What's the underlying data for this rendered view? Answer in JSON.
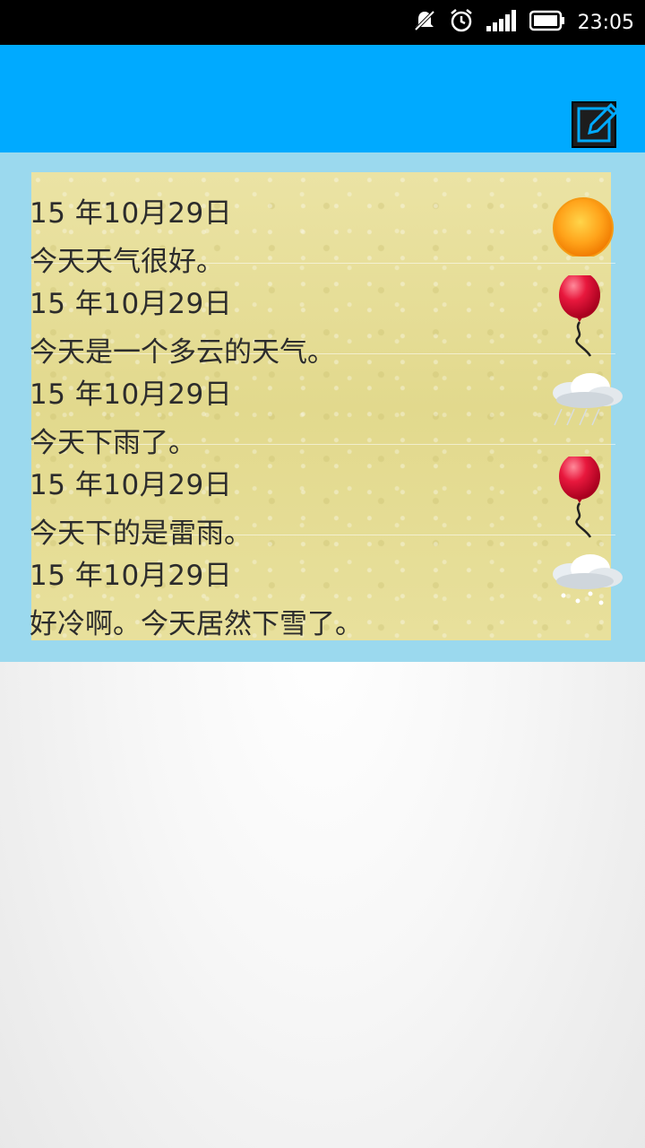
{
  "status_bar": {
    "time": "23:05",
    "icons": [
      "notifications-muted-icon",
      "alarm-clock-icon",
      "signal-strength-icon",
      "battery-icon"
    ]
  },
  "app_bar": {
    "action_icon": "edit-icon",
    "color": "#00aaff"
  },
  "entries": [
    {
      "date": "15 年10月29日",
      "text": "今天天气很好。",
      "icon": "sun-icon"
    },
    {
      "date": "15 年10月29日",
      "text": "今天是一个多云的天气。",
      "icon": "balloon-icon"
    },
    {
      "date": "15 年10月29日",
      "text": "今天下雨了。",
      "icon": "rain-cloud-icon"
    },
    {
      "date": "15 年10月29日",
      "text": "今天下的是雷雨。",
      "icon": "balloon-icon"
    },
    {
      "date": "15 年10月29日",
      "text": "好冷啊。今天居然下雪了。",
      "icon": "snow-cloud-icon"
    }
  ],
  "colors": {
    "content_band": "#9bd9ee",
    "paper": "#e5dc94",
    "text": "#2c2c2c"
  }
}
